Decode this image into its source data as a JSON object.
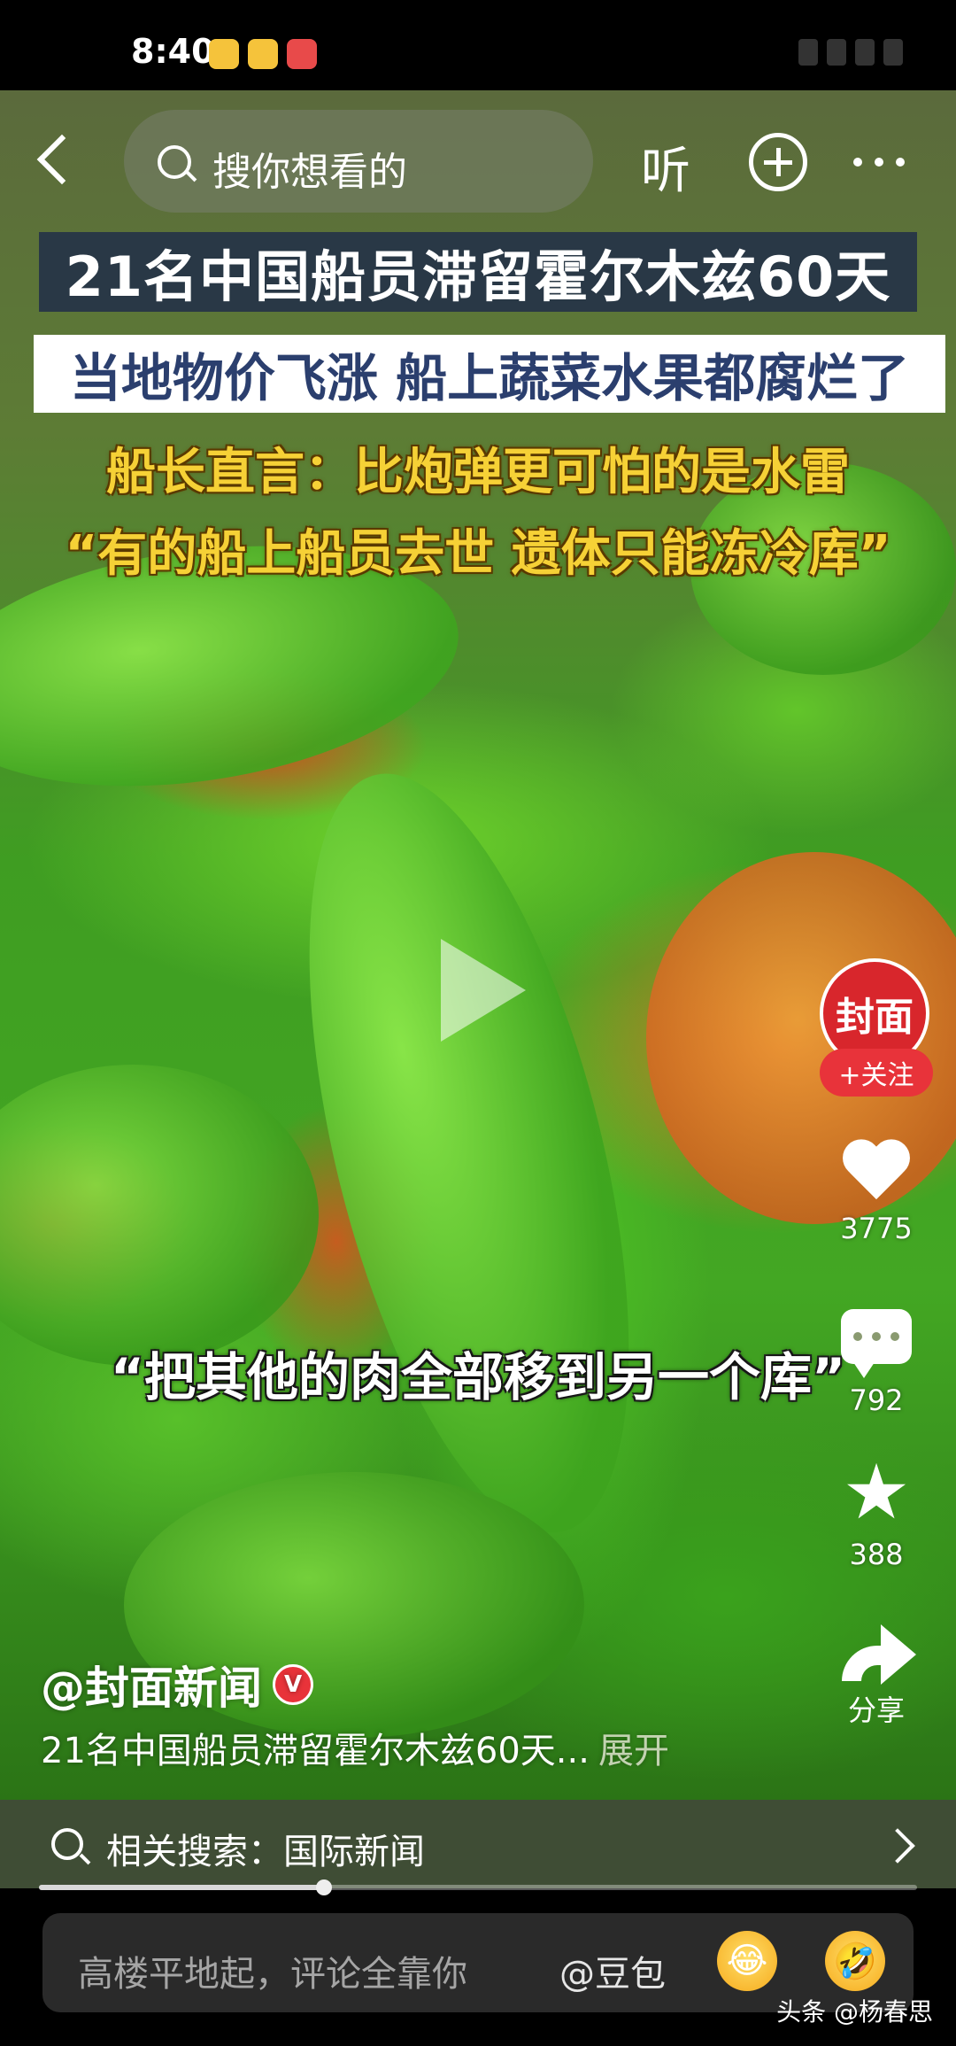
{
  "status_bar": {
    "time": "8:40"
  },
  "top_nav": {
    "search_placeholder": "搜你想看的",
    "listen_label": "听"
  },
  "video": {
    "title_line1": "21名中国船员滞留霍尔木兹60天",
    "title_line2": "当地物价飞涨 船上蔬菜水果都腐烂了",
    "quote_line1": "船长直言：比炮弹更可怕的是水雷",
    "quote_line2": "“有的船上船员去世 遗体只能冻冷库”",
    "subtitle": "“把其他的肉全部移到另一个库”"
  },
  "side_actions": {
    "avatar_text": "封面",
    "follow_label": "+关注",
    "likes": "3775",
    "comments": "792",
    "favorites": "388",
    "share_label": "分享"
  },
  "author": {
    "handle": "@封面新闻",
    "verified_mark": "V",
    "description": "21名中国船员滞留霍尔木兹60天...",
    "expand_label": "展开"
  },
  "related_search": {
    "text": "相关搜索：国际新闻"
  },
  "progress": {
    "fraction": 0.325
  },
  "comment_bar": {
    "placeholder": "高楼平地起，评论全靠你",
    "mention": "@豆包"
  },
  "watermark": "头条 @杨春思",
  "colors": {
    "accent_red": "#e8333a",
    "caption_navy": "#2b3f6e",
    "quote_yellow": "#f6d136"
  },
  "icons": [
    "back-icon",
    "search-icon",
    "plus-circle-icon",
    "more-icon",
    "play-icon",
    "heart-icon",
    "comment-icon",
    "star-icon",
    "share-icon",
    "chevron-right-icon",
    "emoji-icon"
  ]
}
